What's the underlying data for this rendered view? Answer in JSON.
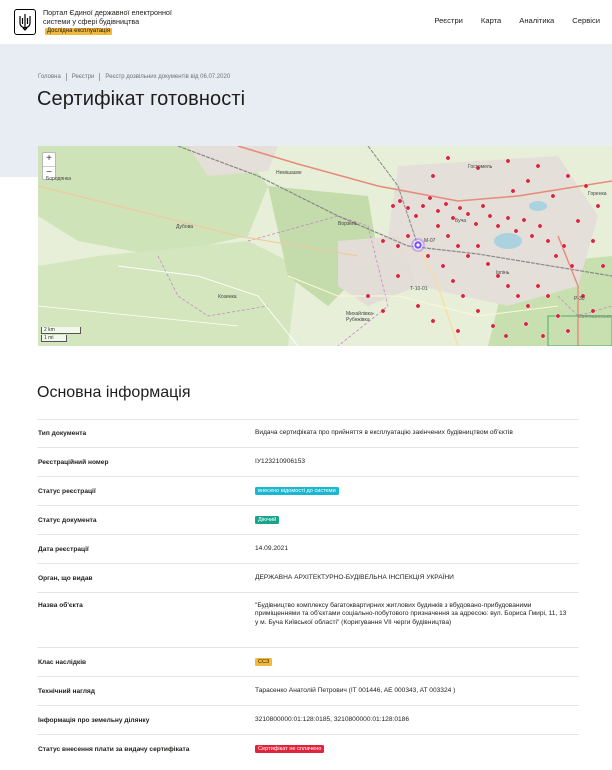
{
  "header": {
    "portal_title": "Портал Єдиної державної електронної системи у сфері будівництва",
    "beta_label": "Дослідна експлуатація",
    "nav": [
      "Реєстри",
      "Карта",
      "Аналітика",
      "Сервіси"
    ]
  },
  "breadcrumb": [
    "Головна",
    "Реєстри",
    "Реєстр дозвільних документів від 06.07.2020"
  ],
  "page_title": "Сертифікат готовності",
  "map": {
    "zoom_in": "+",
    "zoom_out": "−",
    "scale_km": "2 km",
    "scale_mi": "1 mi",
    "places": [
      "Немішаєве",
      "Бородянка",
      "Ворзель",
      "Буча",
      "Ірпінь",
      "Гостомель",
      "Дубова",
      "Козинка",
      "Михайлівка-Рубежівка",
      "Т-10-01",
      "М-07",
      "Р-30",
      "Святошинське",
      "Горенка"
    ]
  },
  "section_title": "Основна інформація",
  "rows": [
    {
      "label": "Тип документа",
      "value": "Видача сертифіката про прийняття в експлуатацію закінчених будівництвом об'єктів"
    },
    {
      "label": "Реєстраційний номер",
      "value": "IУ123210906153"
    },
    {
      "label": "Статус реєстрації",
      "badge": "внесено відомості до системи",
      "badge_color": "#19b8d0"
    },
    {
      "label": "Статус документа",
      "badge": "Діючий",
      "badge_color": "#17a58b"
    },
    {
      "label": "Дата реєстрації",
      "value": "14.09.2021"
    },
    {
      "label": "Орган, що видав",
      "value": "ДЕРЖАВНА АРХІТЕКТУРНО-БУДІВЕЛЬНА ІНСПЕКЦІЯ УКРАЇНИ"
    },
    {
      "label": "Назва об'єкта",
      "value": "\"Будівництво комплексу багатоквартирних житлових будинків з вбудовано-прибудованими приміщеннями та об'єктами соціально-побутового призначення за адресою: вул. Бориса Гмирі, 11, 13 у м. Буча Київської області\" (Коригування VII черги будівництва)"
    },
    {
      "label": "Клас наслідків",
      "badge": "СС3",
      "badge_color": "#f2b83c"
    },
    {
      "label": "Технічний нагляд",
      "value": "Тарасенко Анатолій Петрович (IT 001446, AE 000343, AT 003324 )"
    },
    {
      "label": "Інформація про земельну ділянку",
      "value": "3210800000:01:128:0185, 3210800000:01:128:0186"
    },
    {
      "label": "Статус внесення плати за видачу сертифіката",
      "badge": "Сертифікат не сплачено",
      "badge_color": "#e0243c"
    }
  ]
}
